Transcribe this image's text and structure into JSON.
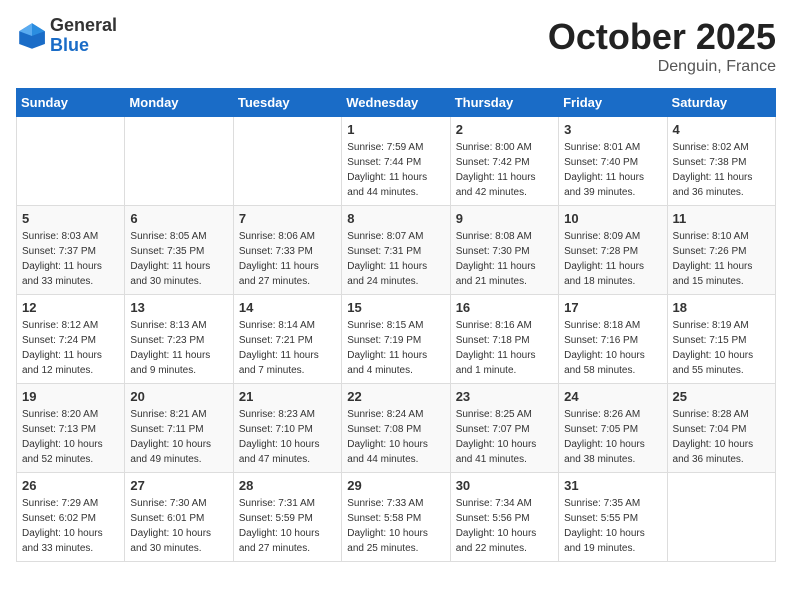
{
  "header": {
    "logo_general": "General",
    "logo_blue": "Blue",
    "month_title": "October 2025",
    "location": "Denguin, France"
  },
  "weekdays": [
    "Sunday",
    "Monday",
    "Tuesday",
    "Wednesday",
    "Thursday",
    "Friday",
    "Saturday"
  ],
  "weeks": [
    [
      {
        "day": "",
        "info": ""
      },
      {
        "day": "",
        "info": ""
      },
      {
        "day": "",
        "info": ""
      },
      {
        "day": "1",
        "info": "Sunrise: 7:59 AM\nSunset: 7:44 PM\nDaylight: 11 hours\nand 44 minutes."
      },
      {
        "day": "2",
        "info": "Sunrise: 8:00 AM\nSunset: 7:42 PM\nDaylight: 11 hours\nand 42 minutes."
      },
      {
        "day": "3",
        "info": "Sunrise: 8:01 AM\nSunset: 7:40 PM\nDaylight: 11 hours\nand 39 minutes."
      },
      {
        "day": "4",
        "info": "Sunrise: 8:02 AM\nSunset: 7:38 PM\nDaylight: 11 hours\nand 36 minutes."
      }
    ],
    [
      {
        "day": "5",
        "info": "Sunrise: 8:03 AM\nSunset: 7:37 PM\nDaylight: 11 hours\nand 33 minutes."
      },
      {
        "day": "6",
        "info": "Sunrise: 8:05 AM\nSunset: 7:35 PM\nDaylight: 11 hours\nand 30 minutes."
      },
      {
        "day": "7",
        "info": "Sunrise: 8:06 AM\nSunset: 7:33 PM\nDaylight: 11 hours\nand 27 minutes."
      },
      {
        "day": "8",
        "info": "Sunrise: 8:07 AM\nSunset: 7:31 PM\nDaylight: 11 hours\nand 24 minutes."
      },
      {
        "day": "9",
        "info": "Sunrise: 8:08 AM\nSunset: 7:30 PM\nDaylight: 11 hours\nand 21 minutes."
      },
      {
        "day": "10",
        "info": "Sunrise: 8:09 AM\nSunset: 7:28 PM\nDaylight: 11 hours\nand 18 minutes."
      },
      {
        "day": "11",
        "info": "Sunrise: 8:10 AM\nSunset: 7:26 PM\nDaylight: 11 hours\nand 15 minutes."
      }
    ],
    [
      {
        "day": "12",
        "info": "Sunrise: 8:12 AM\nSunset: 7:24 PM\nDaylight: 11 hours\nand 12 minutes."
      },
      {
        "day": "13",
        "info": "Sunrise: 8:13 AM\nSunset: 7:23 PM\nDaylight: 11 hours\nand 9 minutes."
      },
      {
        "day": "14",
        "info": "Sunrise: 8:14 AM\nSunset: 7:21 PM\nDaylight: 11 hours\nand 7 minutes."
      },
      {
        "day": "15",
        "info": "Sunrise: 8:15 AM\nSunset: 7:19 PM\nDaylight: 11 hours\nand 4 minutes."
      },
      {
        "day": "16",
        "info": "Sunrise: 8:16 AM\nSunset: 7:18 PM\nDaylight: 11 hours\nand 1 minute."
      },
      {
        "day": "17",
        "info": "Sunrise: 8:18 AM\nSunset: 7:16 PM\nDaylight: 10 hours\nand 58 minutes."
      },
      {
        "day": "18",
        "info": "Sunrise: 8:19 AM\nSunset: 7:15 PM\nDaylight: 10 hours\nand 55 minutes."
      }
    ],
    [
      {
        "day": "19",
        "info": "Sunrise: 8:20 AM\nSunset: 7:13 PM\nDaylight: 10 hours\nand 52 minutes."
      },
      {
        "day": "20",
        "info": "Sunrise: 8:21 AM\nSunset: 7:11 PM\nDaylight: 10 hours\nand 49 minutes."
      },
      {
        "day": "21",
        "info": "Sunrise: 8:23 AM\nSunset: 7:10 PM\nDaylight: 10 hours\nand 47 minutes."
      },
      {
        "day": "22",
        "info": "Sunrise: 8:24 AM\nSunset: 7:08 PM\nDaylight: 10 hours\nand 44 minutes."
      },
      {
        "day": "23",
        "info": "Sunrise: 8:25 AM\nSunset: 7:07 PM\nDaylight: 10 hours\nand 41 minutes."
      },
      {
        "day": "24",
        "info": "Sunrise: 8:26 AM\nSunset: 7:05 PM\nDaylight: 10 hours\nand 38 minutes."
      },
      {
        "day": "25",
        "info": "Sunrise: 8:28 AM\nSunset: 7:04 PM\nDaylight: 10 hours\nand 36 minutes."
      }
    ],
    [
      {
        "day": "26",
        "info": "Sunrise: 7:29 AM\nSunset: 6:02 PM\nDaylight: 10 hours\nand 33 minutes."
      },
      {
        "day": "27",
        "info": "Sunrise: 7:30 AM\nSunset: 6:01 PM\nDaylight: 10 hours\nand 30 minutes."
      },
      {
        "day": "28",
        "info": "Sunrise: 7:31 AM\nSunset: 5:59 PM\nDaylight: 10 hours\nand 27 minutes."
      },
      {
        "day": "29",
        "info": "Sunrise: 7:33 AM\nSunset: 5:58 PM\nDaylight: 10 hours\nand 25 minutes."
      },
      {
        "day": "30",
        "info": "Sunrise: 7:34 AM\nSunset: 5:56 PM\nDaylight: 10 hours\nand 22 minutes."
      },
      {
        "day": "31",
        "info": "Sunrise: 7:35 AM\nSunset: 5:55 PM\nDaylight: 10 hours\nand 19 minutes."
      },
      {
        "day": "",
        "info": ""
      }
    ]
  ]
}
